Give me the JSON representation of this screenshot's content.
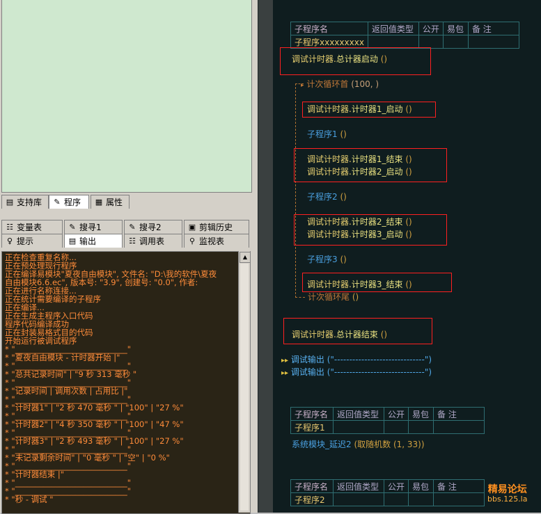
{
  "left": {
    "top_tabs": [
      {
        "label": "支持库",
        "icon": "library-icon"
      },
      {
        "label": "程序",
        "icon": "program-icon",
        "active": true
      },
      {
        "label": "属性",
        "icon": "properties-icon"
      }
    ],
    "tool_tabs_row1": [
      {
        "label": "变量表",
        "icon": "variables-icon"
      },
      {
        "label": "搜寻1",
        "icon": "search-icon"
      },
      {
        "label": "搜寻2",
        "icon": "search-icon"
      },
      {
        "label": "剪辑历史",
        "icon": "clipboard-icon"
      }
    ],
    "tool_tabs_row2": [
      {
        "label": "提示",
        "icon": "hint-icon"
      },
      {
        "label": "输出",
        "icon": "output-icon",
        "active": true
      },
      {
        "label": "调用表",
        "icon": "calltable-icon"
      },
      {
        "label": "监视表",
        "icon": "watch-icon"
      }
    ],
    "output_lines": [
      "正在检查重复名称...",
      "正在预处理现行程序",
      "正在编译易模块\"夏夜自由模块\", 文件名: \"D:\\我的软件\\夏夜",
      "自由模块6.6.ec\", 版本号: \"3.9\", 创建号: \"0.0\", 作者:",
      "",
      "正在进行名称连接...",
      "正在统计需要编译的子程序",
      "正在编译...",
      "正在生成主程序入口代码",
      "程序代码编译成功",
      "正在封装易格式目的代码",
      "开始运行被调试程序",
      "* \"____________________________\"",
      "* \"夏夜自由模块 - 计时器开始 |\"",
      "* \"____________________________\"",
      "* \"总共记录时间\" | \"9 秒 313 毫秒 \"",
      "* \"____________________________\"",
      "* \"记录时间 | 调用次数 | 占用比 |\"",
      "* \"____________________________\"",
      "* \"计时器1\" | \"2 秒 470 毫秒 \" | \"100\" | \"27 %\"",
      "* \"____________________________\"",
      "* \"计时器2\" | \"4 秒 350 毫秒 \" | \"100\" | \"47 %\"",
      "* \"____________________________\"",
      "* \"计时器3\" | \"2 秒 493 毫秒 \" | \"100\" | \"27 %\"",
      "* \"____________________________\"",
      "* \"未记录剩余时间\" | \"0 毫秒 \" | \"空\" | \"0 %\"",
      "* \"____________________________\"",
      "* \"计时器结束 |\"",
      "* \"____________________________\"",
      "* \"____________________________\"",
      "* \"秒 - 调试 \""
    ]
  },
  "editor": {
    "table_headers": [
      "子程序名",
      "返回值类型",
      "公开",
      "易包",
      "备 注"
    ],
    "sub_main_name": "子程序xxxxxxxxx",
    "obj": "调试计时器",
    "lines": {
      "total_start": "总计器启动",
      "loop_head": "计次循环首",
      "loop_args": "(100, )",
      "t1_start": "计时器1_启动",
      "sub1": "子程序1",
      "t1_end": "计时器1_结束",
      "t2_start": "计时器2_启动",
      "sub2": "子程序2",
      "t2_end": "计时器2_结束",
      "t3_start": "计时器3_启动",
      "sub3": "子程序3",
      "t3_end": "计时器3_结束",
      "loop_tail": "计次循环尾",
      "total_end": "总计器结束",
      "paren_call": "()",
      "debug_out": "调试输出",
      "debug_arg": "(\"------------------------------\")"
    },
    "sub1_table_name": "子程序1",
    "sub1_code": "系统模块_延迟2",
    "sub1_code_arg": "(取随机数 (1, 33))",
    "sub2_table_name": "子程序2"
  },
  "watermark": {
    "line1": "精易论坛",
    "line2": "bbs.125.la"
  }
}
